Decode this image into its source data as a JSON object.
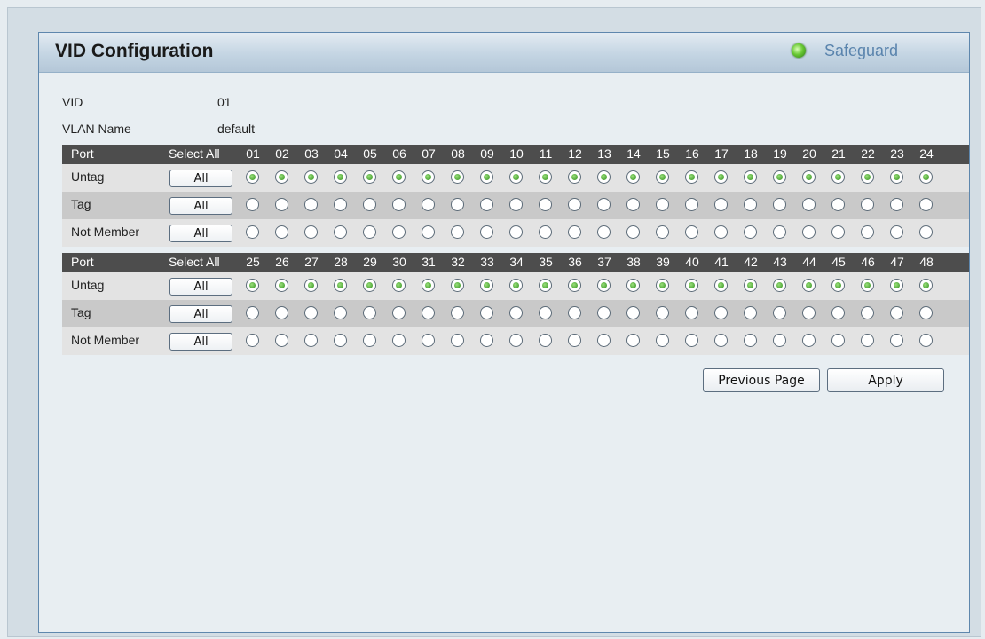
{
  "header": {
    "title": "VID Configuration",
    "safeguard_label": "Safeguard"
  },
  "vid": {
    "label": "VID",
    "value": "01"
  },
  "vlan_name": {
    "label": "VLAN Name",
    "value": "default"
  },
  "tables": [
    {
      "port_label": "Port",
      "select_all_label": "Select All",
      "ports": [
        "01",
        "02",
        "03",
        "04",
        "05",
        "06",
        "07",
        "08",
        "09",
        "10",
        "11",
        "12",
        "13",
        "14",
        "15",
        "16",
        "17",
        "18",
        "19",
        "20",
        "21",
        "22",
        "23",
        "24"
      ],
      "rows": [
        {
          "label": "Untag",
          "button": "All",
          "selected": true
        },
        {
          "label": "Tag",
          "button": "All",
          "selected": false
        },
        {
          "label": "Not Member",
          "button": "All",
          "selected": false
        }
      ]
    },
    {
      "port_label": "Port",
      "select_all_label": "Select All",
      "ports": [
        "25",
        "26",
        "27",
        "28",
        "29",
        "30",
        "31",
        "32",
        "33",
        "34",
        "35",
        "36",
        "37",
        "38",
        "39",
        "40",
        "41",
        "42",
        "43",
        "44",
        "45",
        "46",
        "47",
        "48"
      ],
      "rows": [
        {
          "label": "Untag",
          "button": "All",
          "selected": true
        },
        {
          "label": "Tag",
          "button": "All",
          "selected": false
        },
        {
          "label": "Not Member",
          "button": "All",
          "selected": false
        }
      ]
    }
  ],
  "buttons": {
    "previous_page": "Previous Page",
    "apply": "Apply"
  }
}
